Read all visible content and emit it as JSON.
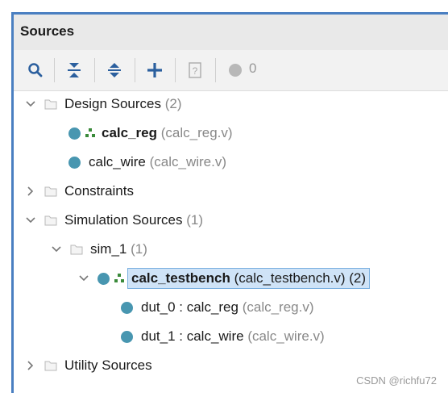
{
  "panel": {
    "title": "Sources"
  },
  "toolbar": {
    "count": "0"
  },
  "tree": {
    "design_sources": {
      "label": "Design Sources",
      "count": "(2)"
    },
    "calc_reg": {
      "label": "calc_reg",
      "file": "(calc_reg.v)"
    },
    "calc_wire": {
      "label": "calc_wire",
      "file": "(calc_wire.v)"
    },
    "constraints": {
      "label": "Constraints"
    },
    "simulation_sources": {
      "label": "Simulation Sources",
      "count": "(1)"
    },
    "sim_1": {
      "label": "sim_1",
      "count": "(1)"
    },
    "calc_testbench": {
      "label": "calc_testbench",
      "file": "(calc_testbench.v) (2)"
    },
    "dut_0": {
      "label": "dut_0 : calc_reg",
      "file": "(calc_reg.v)"
    },
    "dut_1": {
      "label": "dut_1 : calc_wire",
      "file": "(calc_wire.v)"
    },
    "utility_sources": {
      "label": "Utility Sources"
    }
  },
  "watermark": "CSDN @richfu72",
  "colors": {
    "accent": "#4a7fc1",
    "dot": "#4896b0",
    "selection": "#cfe3f7",
    "icon_blue": "#2b5f9e"
  }
}
